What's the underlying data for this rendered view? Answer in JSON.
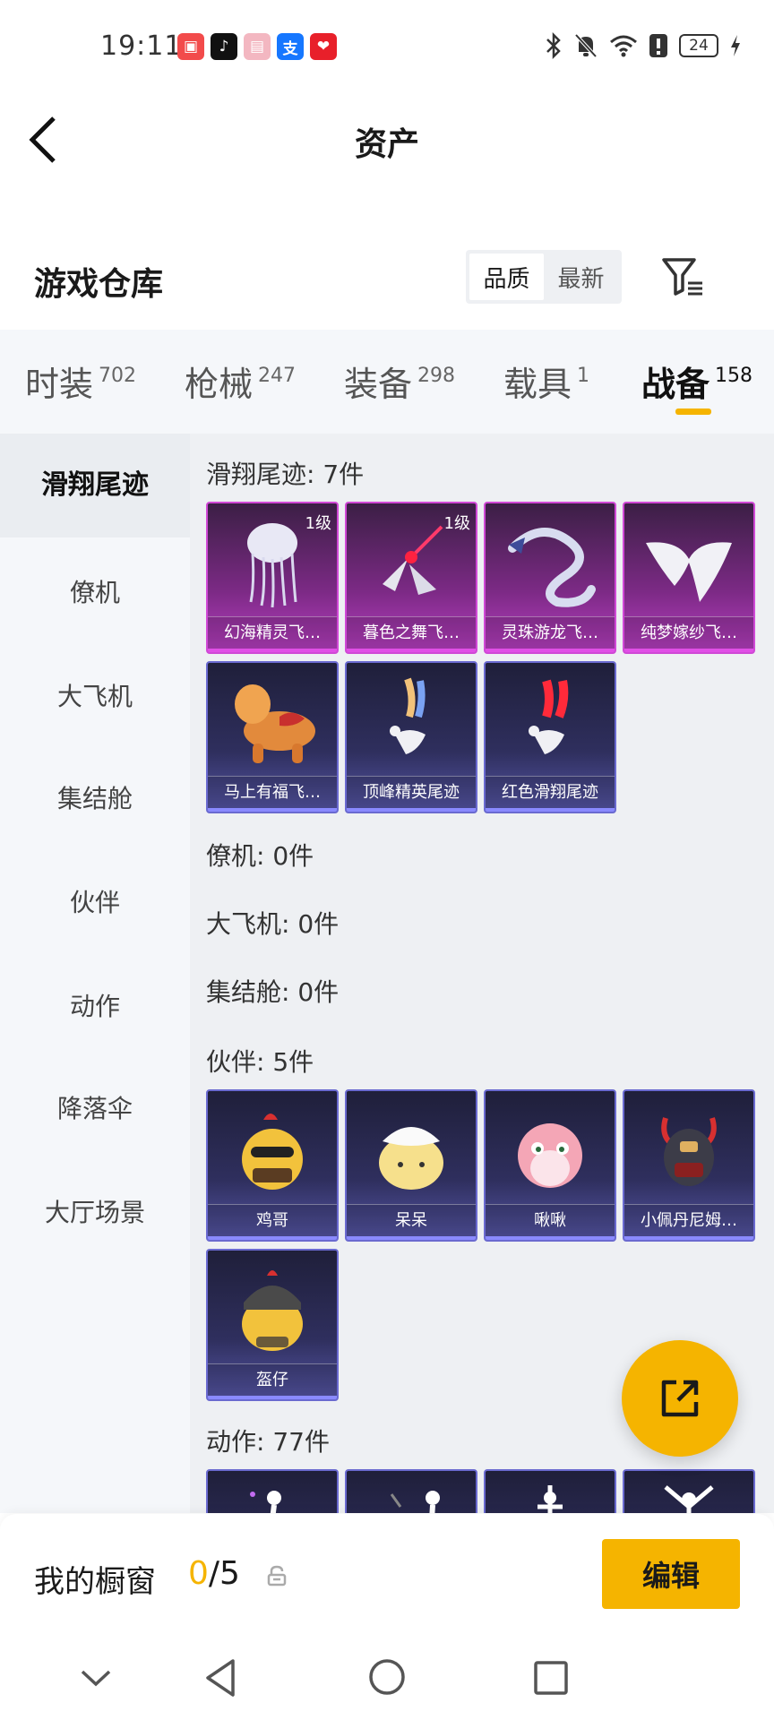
{
  "status": {
    "time": "19:11",
    "battery": "24",
    "app_icons": [
      {
        "name": "shop-app-icon",
        "color": "#f24b4b",
        "glyph": "▣"
      },
      {
        "name": "tiktok-app-icon",
        "color": "#111111",
        "glyph": "♪"
      },
      {
        "name": "gift-app-icon",
        "color": "#f3b7c1",
        "glyph": "▤"
      },
      {
        "name": "alipay-app-icon",
        "color": "#1677ff",
        "glyph": "支"
      },
      {
        "name": "heart-app-icon",
        "color": "#e8202a",
        "glyph": "❤"
      }
    ]
  },
  "header": {
    "title": "资产"
  },
  "warehouse": {
    "title": "游戏仓库",
    "sort_quality": "品质",
    "sort_newest": "最新"
  },
  "tabs": [
    {
      "label": "时装",
      "count": "702"
    },
    {
      "label": "枪械",
      "count": "247"
    },
    {
      "label": "装备",
      "count": "298"
    },
    {
      "label": "载具",
      "count": "1"
    },
    {
      "label": "战备",
      "count": "158"
    }
  ],
  "side_menu": [
    "滑翔尾迹",
    "僚机",
    "大飞机",
    "集结舱",
    "伙伴",
    "动作",
    "降落伞",
    "大厅场景"
  ],
  "sections": {
    "glide_trail": {
      "title": "滑翔尾迹: 7件",
      "items": [
        {
          "name": "幻海精灵飞…",
          "level": "1级"
        },
        {
          "name": "暮色之舞飞…",
          "level": "1级"
        },
        {
          "name": "灵珠游龙飞…",
          "level": ""
        },
        {
          "name": "纯梦嫁纱飞…",
          "level": ""
        },
        {
          "name": "马上有福飞…",
          "level": ""
        },
        {
          "name": "顶峰精英尾迹",
          "level": ""
        },
        {
          "name": "红色滑翔尾迹",
          "level": ""
        }
      ]
    },
    "wingman": {
      "title": "僚机: 0件"
    },
    "big_plane": {
      "title": "大飞机: 0件"
    },
    "pod": {
      "title": "集结舱: 0件"
    },
    "partner": {
      "title": "伙伴: 5件",
      "items": [
        {
          "name": "鸡哥"
        },
        {
          "name": "呆呆"
        },
        {
          "name": "啾啾"
        },
        {
          "name": "小佩丹尼姆…"
        },
        {
          "name": "盔仔"
        }
      ]
    },
    "emote": {
      "title": "动作: 77件"
    }
  },
  "showcase": {
    "label": "我的橱窗",
    "current": "0",
    "total": "/5",
    "edit_label": "编辑"
  }
}
